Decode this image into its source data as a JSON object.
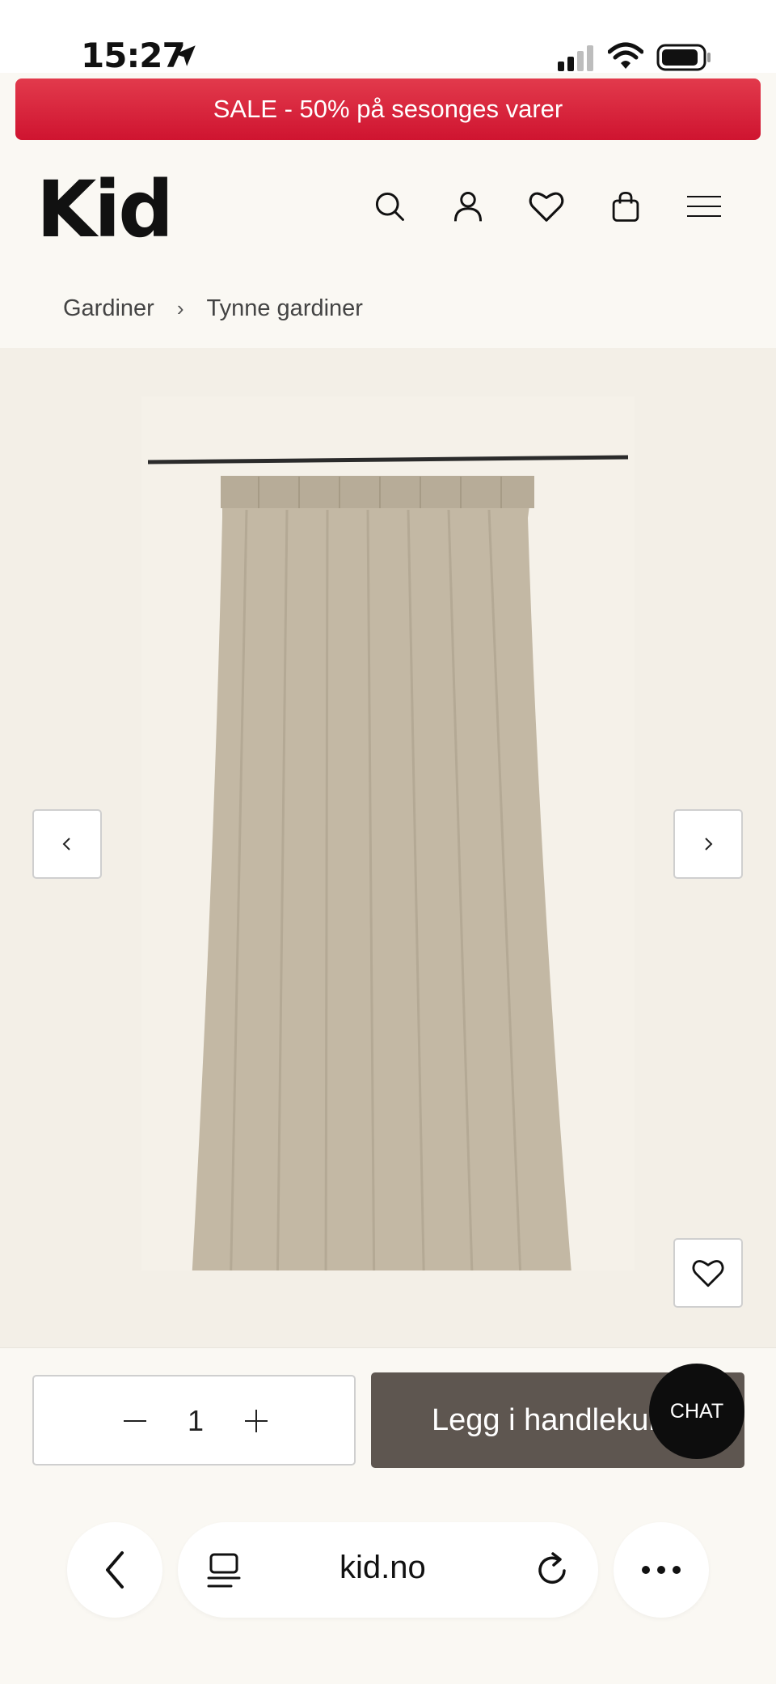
{
  "status_bar": {
    "time": "15:27"
  },
  "banner": {
    "text": "SALE - 50% på sesonges varer",
    "color": "#d81f36"
  },
  "header": {
    "logo": "Kid",
    "icons": [
      "search-icon",
      "user-icon",
      "heart-icon",
      "bag-icon",
      "menu-icon"
    ]
  },
  "breadcrumb": {
    "items": [
      "Gardiner",
      "Tynne gardiner"
    ]
  },
  "gallery": {
    "image": "curtain-product-image"
  },
  "purchase": {
    "quantity": "1",
    "add_to_cart_label": "Legg i handlekurv",
    "button_color": "#5e5650"
  },
  "chat": {
    "label": "CHAT"
  },
  "browser": {
    "url": "kid.no"
  }
}
